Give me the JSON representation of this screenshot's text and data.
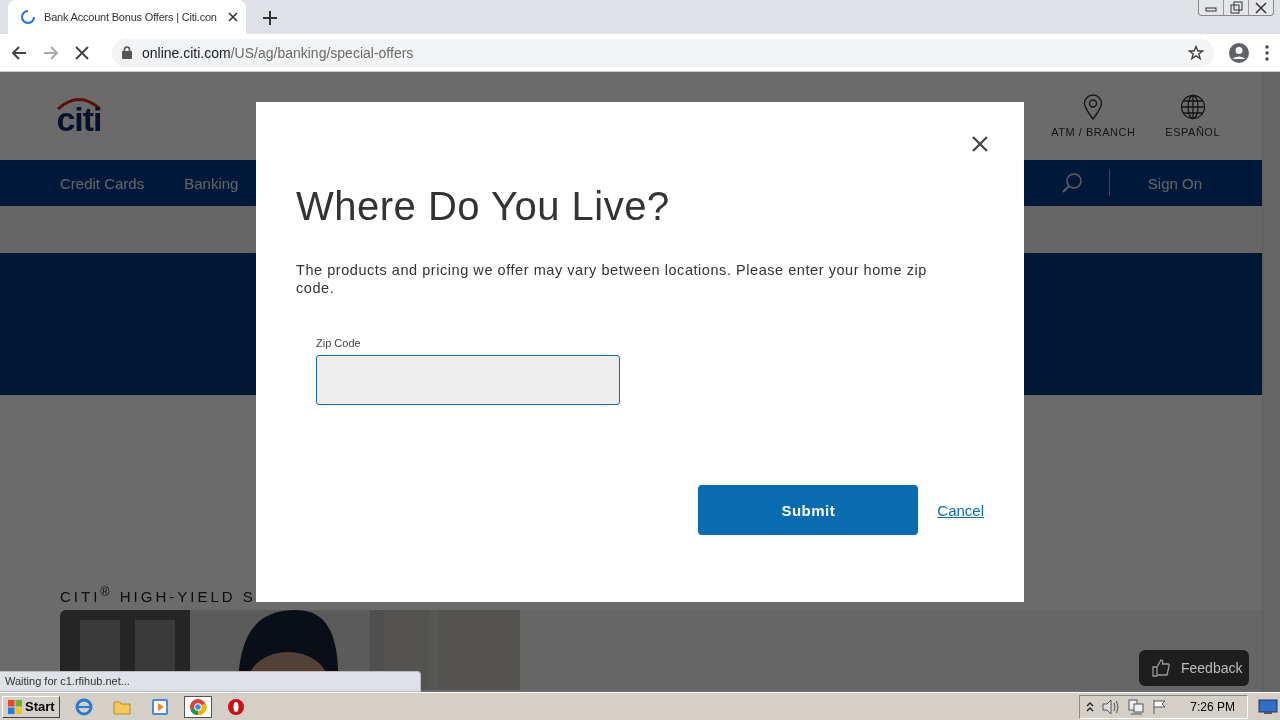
{
  "browser": {
    "tab_title": "Bank Account Bonus Offers | Citi.con",
    "address_domain": "online.citi.com",
    "address_path": "/US/ag/banking/special-offers",
    "status_text": "Waiting for c1.rfihub.net..."
  },
  "page": {
    "logo": "citi",
    "utility_links": [
      {
        "kind": "pin",
        "label": "ATM / BRANCH"
      },
      {
        "kind": "globe",
        "label": "ESPAÑOL"
      }
    ],
    "nav_items": [
      "Credit Cards",
      "Banking"
    ],
    "sign_on": "Sign On",
    "section_title": "CITI$^{®}$ HIGH-YIELD S",
    "feedback": "Feedback"
  },
  "modal": {
    "title": "Where Do You Live?",
    "text": "The products and pricing we offer may vary between locations. Please enter your home zip code.",
    "zip_label": "Zip Code",
    "submit": "Submit",
    "cancel": "Cancel"
  },
  "taskbar": {
    "start": "Start",
    "clock": "7:26 PM"
  }
}
